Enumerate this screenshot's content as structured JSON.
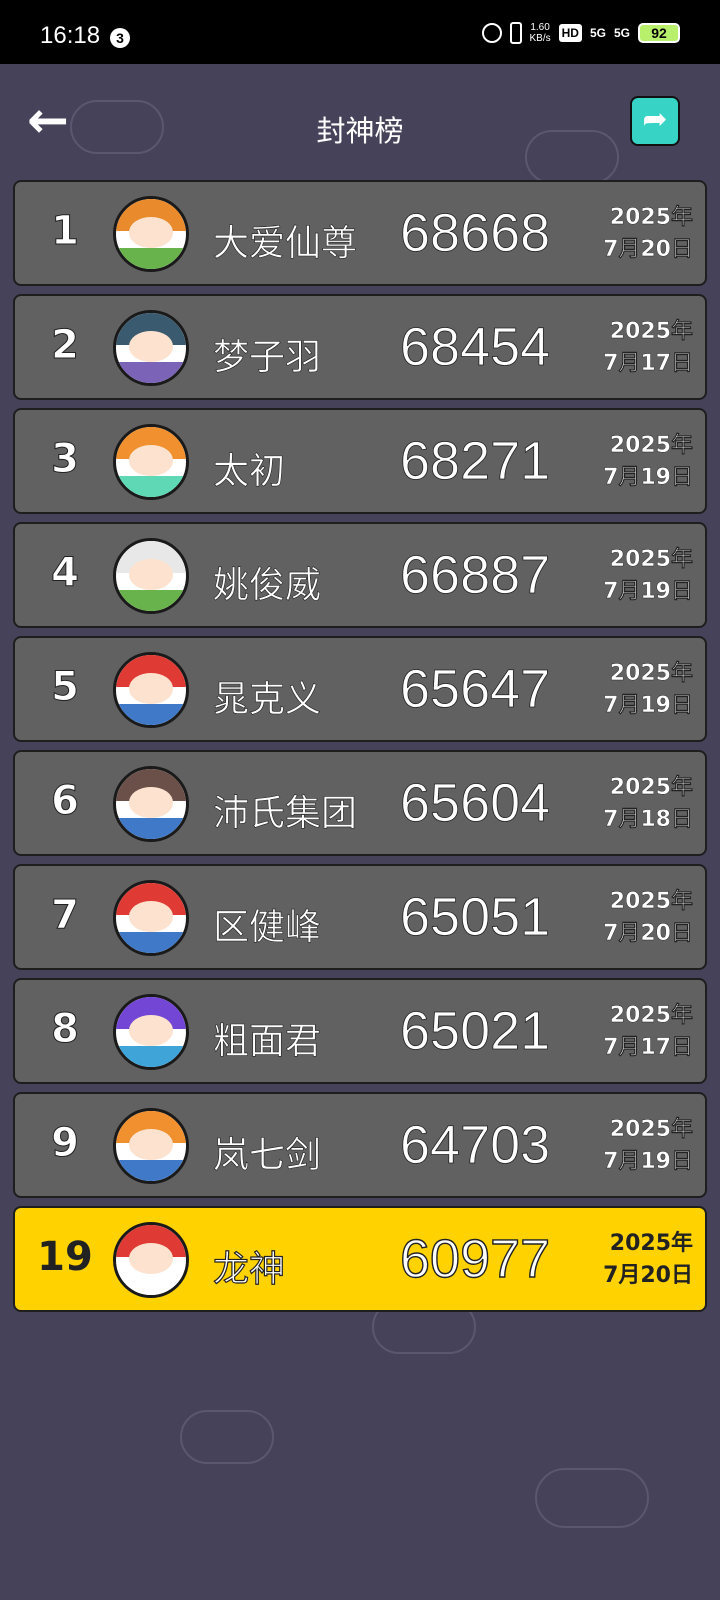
{
  "status_bar": {
    "time": "16:18",
    "notification_count": "3",
    "net_speed_value": "1.60",
    "net_speed_unit": "KB/s",
    "hd_label": "HD",
    "signal_1": "5G",
    "signal_2": "5G",
    "battery": "92"
  },
  "header": {
    "title": "封神榜",
    "back_icon": "back-arrow-icon",
    "share_icon": "share-icon"
  },
  "leaderboard": [
    {
      "rank": "1",
      "name": "大爱仙尊",
      "score": "68668",
      "year": "2025年",
      "day": "7月20日",
      "hair": "#e98a2c",
      "body": "#69b34c",
      "highlight": false
    },
    {
      "rank": "2",
      "name": "梦子羽",
      "score": "68454",
      "year": "2025年",
      "day": "7月17日",
      "hair": "#3a5a70",
      "body": "#7b63b7",
      "highlight": false
    },
    {
      "rank": "3",
      "name": "太初",
      "score": "68271",
      "year": "2025年",
      "day": "7月19日",
      "hair": "#f0902e",
      "body": "#5fd9b5",
      "highlight": false
    },
    {
      "rank": "4",
      "name": "姚俊威",
      "score": "66887",
      "year": "2025年",
      "day": "7月19日",
      "hair": "#e8e8e8",
      "body": "#69b34c",
      "highlight": false
    },
    {
      "rank": "5",
      "name": "晁克义",
      "score": "65647",
      "year": "2025年",
      "day": "7月19日",
      "hair": "#e03a34",
      "body": "#3f79c7",
      "highlight": false
    },
    {
      "rank": "6",
      "name": "沛氏集团",
      "score": "65604",
      "year": "2025年",
      "day": "7月18日",
      "hair": "#6b4f49",
      "body": "#3f79c7",
      "highlight": false
    },
    {
      "rank": "7",
      "name": "区健峰",
      "score": "65051",
      "year": "2025年",
      "day": "7月20日",
      "hair": "#e03a34",
      "body": "#3f79c7",
      "highlight": false
    },
    {
      "rank": "8",
      "name": "粗面君",
      "score": "65021",
      "year": "2025年",
      "day": "7月17日",
      "hair": "#7446d6",
      "body": "#3fa5d8",
      "highlight": false
    },
    {
      "rank": "9",
      "name": "岚七剑",
      "score": "64703",
      "year": "2025年",
      "day": "7月19日",
      "hair": "#f0902e",
      "body": "#3f79c7",
      "highlight": false
    },
    {
      "rank": "19",
      "name": "龙神",
      "score": "60977",
      "year": "2025年",
      "day": "7月20日",
      "hair": "#e03a34",
      "body": "#ffffff",
      "highlight": true
    }
  ]
}
